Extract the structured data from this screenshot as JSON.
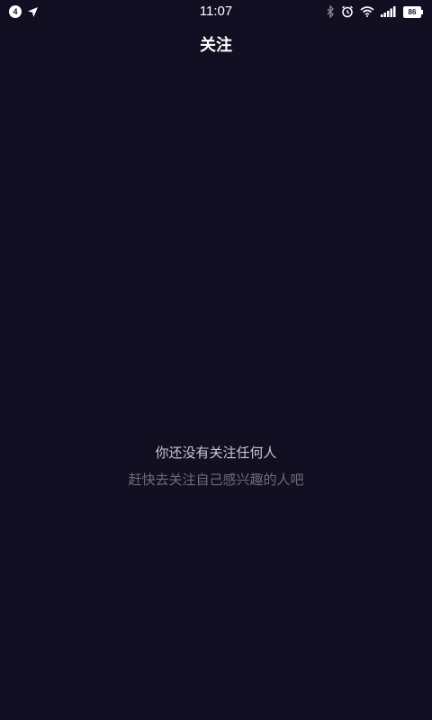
{
  "status_bar": {
    "notification_count": "4",
    "time": "11:07",
    "battery_level": "86",
    "icons": [
      "location-arrow-icon",
      "bluetooth-icon",
      "alarm-icon",
      "wifi-icon",
      "signal-icon",
      "battery-icon"
    ]
  },
  "header": {
    "title": "关注"
  },
  "empty_state": {
    "title": "你还没有关注任何人",
    "subtitle": "赶快去关注自己感兴趣的人吧"
  },
  "colors": {
    "background": "#120f23",
    "primary_text": "#ffffff",
    "secondary_text": "#c9c8d0",
    "muted_text": "#6e6c7c"
  }
}
